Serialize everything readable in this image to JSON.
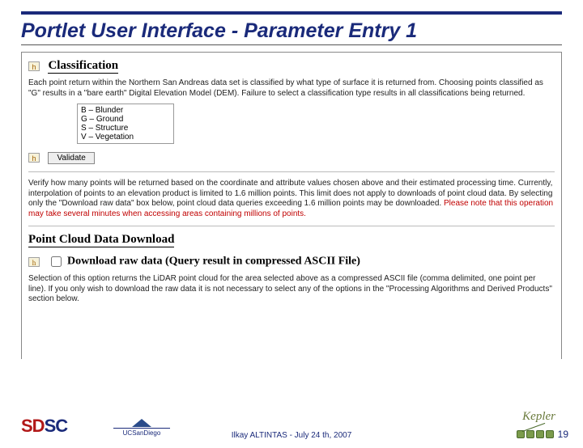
{
  "slide": {
    "title": "Portlet User Interface - Parameter Entry 1"
  },
  "classification": {
    "help_chip": "h",
    "heading": "Classification",
    "description": "Each point return within the Northern San Andreas data set is classified by what type of surface it is returned from. Choosing points classified as \"G\" results in a \"bare earth\" Digital Elevation Model (DEM). Failure to select a classification type results in all classifications being returned.",
    "options": [
      "B – Blunder",
      "G – Ground",
      "S – Structure",
      "V – Vegetation"
    ]
  },
  "validate": {
    "help_chip": "h",
    "button": "Validate",
    "description_plain": "Verify how many points will be returned based on the coordinate and attribute values chosen above and their estimated processing time. Currently, interpolation of points to an elevation product is limited to 1.6 million points. This limit does not apply to downloads of point cloud data. By selecting only the \"Download raw data\" box below, point cloud data queries exceeding 1.6 million points may be downloaded. ",
    "description_warn": "Please note that this operation may take several minutes when accessing areas containing millions of points."
  },
  "download": {
    "heading": "Point Cloud Data Download",
    "help_chip": "h",
    "checkbox_label": "Download raw data (Query result in compressed ASCII File)",
    "description": "Selection of this option returns the LiDAR point cloud for the area selected above as a compressed ASCII file (comma delimited, one point per line). If you only wish to download the raw data it is not necessary to select any of the options in the \"Processing Algorithms and Derived Products\" section below."
  },
  "footer": {
    "center": "Ilkay ALTINTAS - July 24 th, 2007",
    "page": "19",
    "sdsc": "SDSC",
    "ucsd": "UCSanDiego",
    "kepler": "Kepler"
  }
}
